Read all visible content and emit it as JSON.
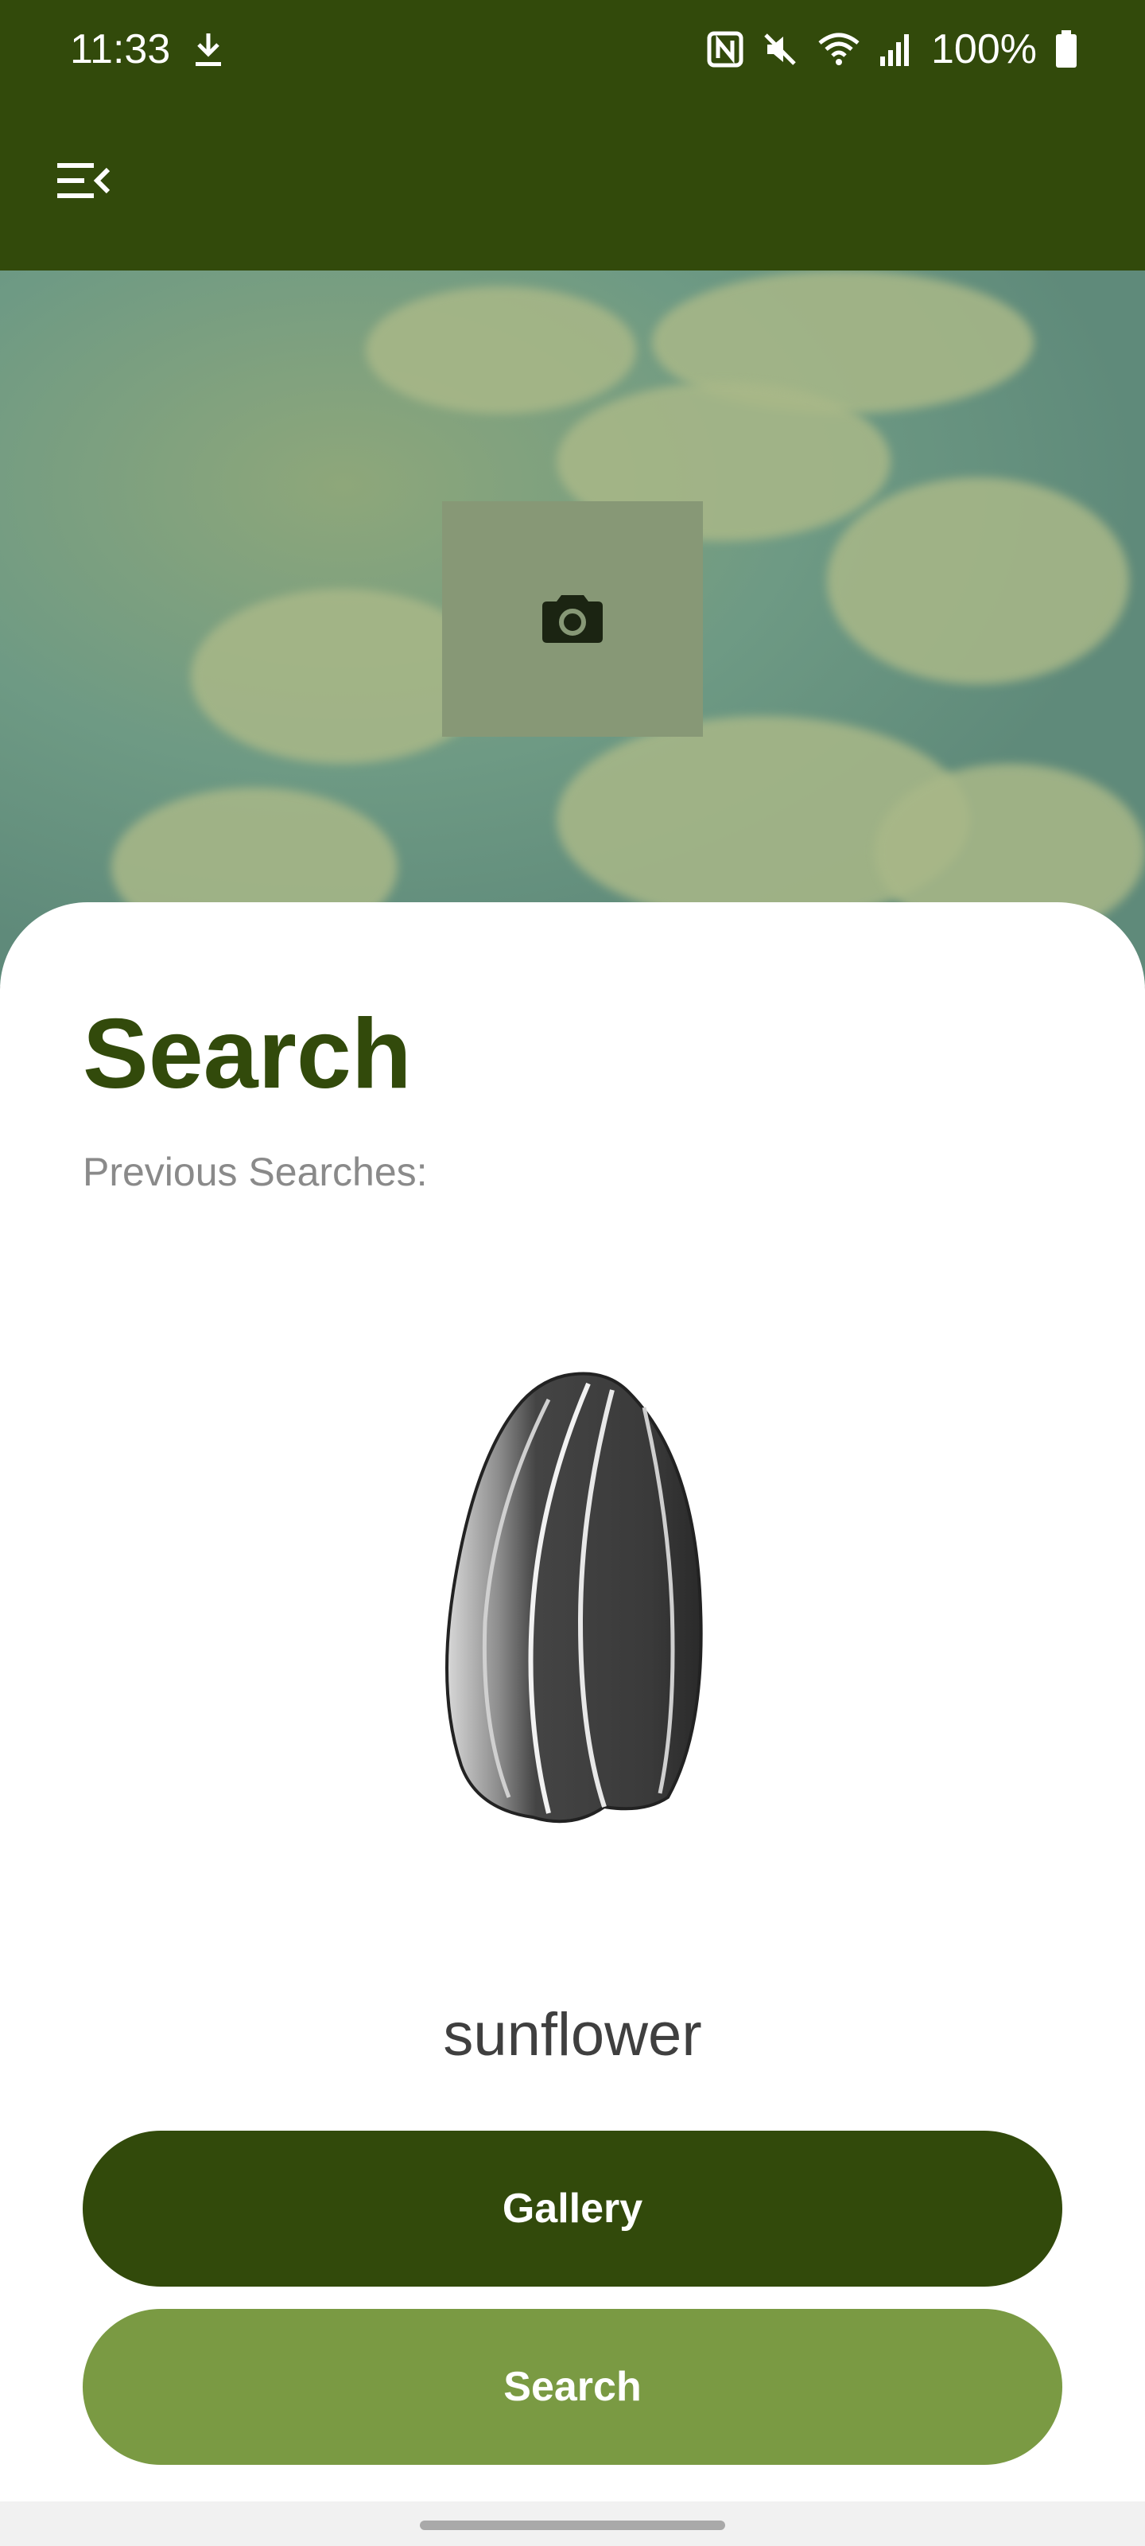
{
  "status_bar": {
    "time": "11:33",
    "battery": "100%",
    "icons": [
      "download-icon",
      "nfc-icon",
      "mute-icon",
      "wifi-icon",
      "signal-icon",
      "battery-icon"
    ]
  },
  "app_bar": {
    "menu_icon": "menu-collapse-icon"
  },
  "hero": {
    "camera_icon": "camera-icon"
  },
  "search": {
    "title": "Search",
    "previous_label": "Previous Searches:",
    "result_label": "sunflower"
  },
  "buttons": {
    "gallery": "Gallery",
    "search": "Search"
  },
  "colors": {
    "primary": "#324a0b",
    "secondary": "#7a9a43",
    "background": "#ffffff"
  }
}
